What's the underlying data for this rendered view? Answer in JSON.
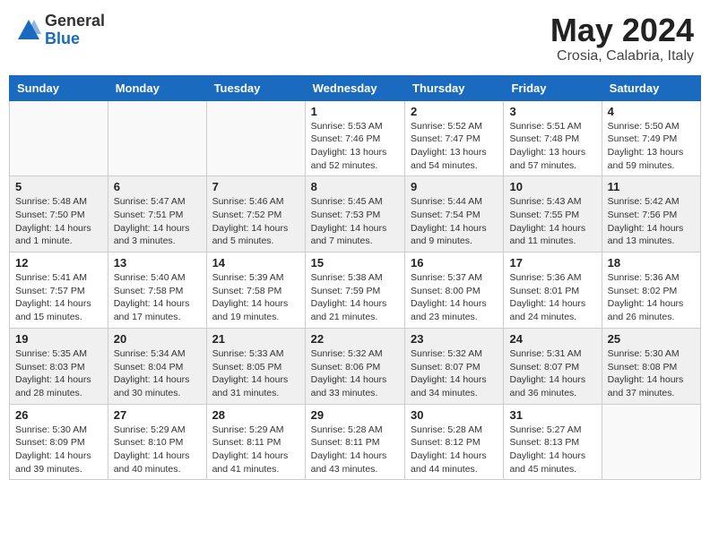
{
  "header": {
    "logo_general": "General",
    "logo_blue": "Blue",
    "month": "May 2024",
    "location": "Crosia, Calabria, Italy"
  },
  "days_of_week": [
    "Sunday",
    "Monday",
    "Tuesday",
    "Wednesday",
    "Thursday",
    "Friday",
    "Saturday"
  ],
  "weeks": [
    [
      {
        "day": "",
        "info": ""
      },
      {
        "day": "",
        "info": ""
      },
      {
        "day": "",
        "info": ""
      },
      {
        "day": "1",
        "info": "Sunrise: 5:53 AM\nSunset: 7:46 PM\nDaylight: 13 hours and 52 minutes."
      },
      {
        "day": "2",
        "info": "Sunrise: 5:52 AM\nSunset: 7:47 PM\nDaylight: 13 hours and 54 minutes."
      },
      {
        "day": "3",
        "info": "Sunrise: 5:51 AM\nSunset: 7:48 PM\nDaylight: 13 hours and 57 minutes."
      },
      {
        "day": "4",
        "info": "Sunrise: 5:50 AM\nSunset: 7:49 PM\nDaylight: 13 hours and 59 minutes."
      }
    ],
    [
      {
        "day": "5",
        "info": "Sunrise: 5:48 AM\nSunset: 7:50 PM\nDaylight: 14 hours and 1 minute."
      },
      {
        "day": "6",
        "info": "Sunrise: 5:47 AM\nSunset: 7:51 PM\nDaylight: 14 hours and 3 minutes."
      },
      {
        "day": "7",
        "info": "Sunrise: 5:46 AM\nSunset: 7:52 PM\nDaylight: 14 hours and 5 minutes."
      },
      {
        "day": "8",
        "info": "Sunrise: 5:45 AM\nSunset: 7:53 PM\nDaylight: 14 hours and 7 minutes."
      },
      {
        "day": "9",
        "info": "Sunrise: 5:44 AM\nSunset: 7:54 PM\nDaylight: 14 hours and 9 minutes."
      },
      {
        "day": "10",
        "info": "Sunrise: 5:43 AM\nSunset: 7:55 PM\nDaylight: 14 hours and 11 minutes."
      },
      {
        "day": "11",
        "info": "Sunrise: 5:42 AM\nSunset: 7:56 PM\nDaylight: 14 hours and 13 minutes."
      }
    ],
    [
      {
        "day": "12",
        "info": "Sunrise: 5:41 AM\nSunset: 7:57 PM\nDaylight: 14 hours and 15 minutes."
      },
      {
        "day": "13",
        "info": "Sunrise: 5:40 AM\nSunset: 7:58 PM\nDaylight: 14 hours and 17 minutes."
      },
      {
        "day": "14",
        "info": "Sunrise: 5:39 AM\nSunset: 7:58 PM\nDaylight: 14 hours and 19 minutes."
      },
      {
        "day": "15",
        "info": "Sunrise: 5:38 AM\nSunset: 7:59 PM\nDaylight: 14 hours and 21 minutes."
      },
      {
        "day": "16",
        "info": "Sunrise: 5:37 AM\nSunset: 8:00 PM\nDaylight: 14 hours and 23 minutes."
      },
      {
        "day": "17",
        "info": "Sunrise: 5:36 AM\nSunset: 8:01 PM\nDaylight: 14 hours and 24 minutes."
      },
      {
        "day": "18",
        "info": "Sunrise: 5:36 AM\nSunset: 8:02 PM\nDaylight: 14 hours and 26 minutes."
      }
    ],
    [
      {
        "day": "19",
        "info": "Sunrise: 5:35 AM\nSunset: 8:03 PM\nDaylight: 14 hours and 28 minutes."
      },
      {
        "day": "20",
        "info": "Sunrise: 5:34 AM\nSunset: 8:04 PM\nDaylight: 14 hours and 30 minutes."
      },
      {
        "day": "21",
        "info": "Sunrise: 5:33 AM\nSunset: 8:05 PM\nDaylight: 14 hours and 31 minutes."
      },
      {
        "day": "22",
        "info": "Sunrise: 5:32 AM\nSunset: 8:06 PM\nDaylight: 14 hours and 33 minutes."
      },
      {
        "day": "23",
        "info": "Sunrise: 5:32 AM\nSunset: 8:07 PM\nDaylight: 14 hours and 34 minutes."
      },
      {
        "day": "24",
        "info": "Sunrise: 5:31 AM\nSunset: 8:07 PM\nDaylight: 14 hours and 36 minutes."
      },
      {
        "day": "25",
        "info": "Sunrise: 5:30 AM\nSunset: 8:08 PM\nDaylight: 14 hours and 37 minutes."
      }
    ],
    [
      {
        "day": "26",
        "info": "Sunrise: 5:30 AM\nSunset: 8:09 PM\nDaylight: 14 hours and 39 minutes."
      },
      {
        "day": "27",
        "info": "Sunrise: 5:29 AM\nSunset: 8:10 PM\nDaylight: 14 hours and 40 minutes."
      },
      {
        "day": "28",
        "info": "Sunrise: 5:29 AM\nSunset: 8:11 PM\nDaylight: 14 hours and 41 minutes."
      },
      {
        "day": "29",
        "info": "Sunrise: 5:28 AM\nSunset: 8:11 PM\nDaylight: 14 hours and 43 minutes."
      },
      {
        "day": "30",
        "info": "Sunrise: 5:28 AM\nSunset: 8:12 PM\nDaylight: 14 hours and 44 minutes."
      },
      {
        "day": "31",
        "info": "Sunrise: 5:27 AM\nSunset: 8:13 PM\nDaylight: 14 hours and 45 minutes."
      },
      {
        "day": "",
        "info": ""
      }
    ]
  ]
}
